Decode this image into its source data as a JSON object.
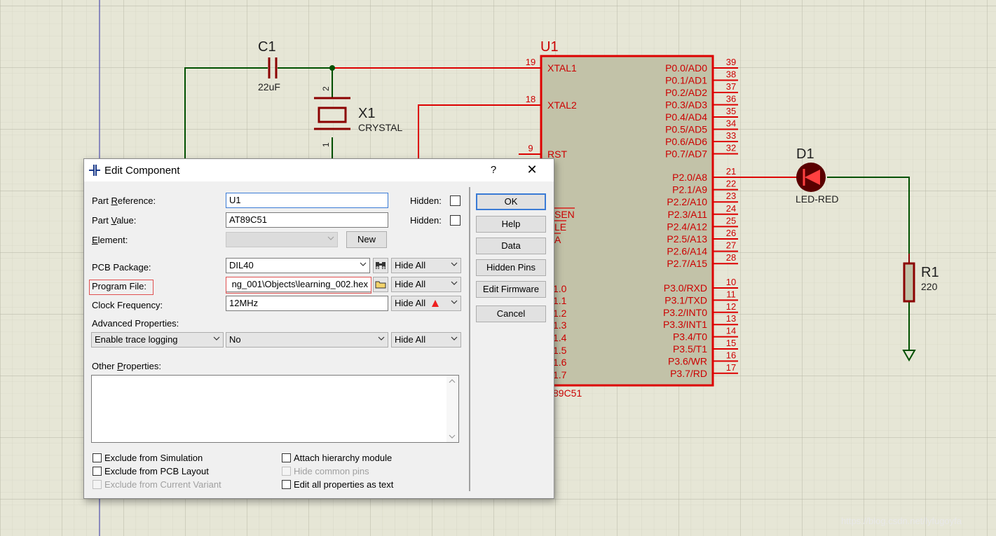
{
  "schematic": {
    "capacitor": {
      "ref": "C1",
      "value": "22uF"
    },
    "crystal": {
      "ref": "X1",
      "value": "CRYSTAL",
      "pin_top": "2",
      "pin_bottom": "1"
    },
    "ic": {
      "ref": "U1",
      "name_partial": "89C51",
      "left_pins": [
        {
          "num": "19",
          "name": "XTAL1"
        },
        {
          "num": "18",
          "name": "XTAL2"
        },
        {
          "num": "9",
          "name": "RST"
        }
      ],
      "left_partial_labels": [
        "SEN",
        "LE",
        "A",
        "1.0",
        "1.1",
        "1.2",
        "1.3",
        "1.4",
        "1.5",
        "1.6",
        "1.7"
      ],
      "right_pins": [
        {
          "name": "P0.0/AD0",
          "num": "39"
        },
        {
          "name": "P0.1/AD1",
          "num": "38"
        },
        {
          "name": "P0.2/AD2",
          "num": "37"
        },
        {
          "name": "P0.3/AD3",
          "num": "36"
        },
        {
          "name": "P0.4/AD4",
          "num": "35"
        },
        {
          "name": "P0.5/AD5",
          "num": "34"
        },
        {
          "name": "P0.6/AD6",
          "num": "33"
        },
        {
          "name": "P0.7/AD7",
          "num": "32"
        },
        {
          "name": "P2.0/A8",
          "num": "21"
        },
        {
          "name": "P2.1/A9",
          "num": "22"
        },
        {
          "name": "P2.2/A10",
          "num": "23"
        },
        {
          "name": "P2.3/A11",
          "num": "24"
        },
        {
          "name": "P2.4/A12",
          "num": "25"
        },
        {
          "name": "P2.5/A13",
          "num": "26"
        },
        {
          "name": "P2.6/A14",
          "num": "27"
        },
        {
          "name": "P2.7/A15",
          "num": "28"
        },
        {
          "name": "P3.0/RXD",
          "num": "10"
        },
        {
          "name": "P3.1/TXD",
          "num": "11"
        },
        {
          "name": "P3.2/INT0",
          "num": "12"
        },
        {
          "name": "P3.3/INT1",
          "num": "13"
        },
        {
          "name": "P3.4/T0",
          "num": "14"
        },
        {
          "name": "P3.5/T1",
          "num": "15"
        },
        {
          "name": "P3.6/WR",
          "num": "16"
        },
        {
          "name": "P3.7/RD",
          "num": "17"
        }
      ]
    },
    "led": {
      "ref": "D1",
      "value": "LED-RED"
    },
    "resistor": {
      "ref": "R1",
      "value": "220"
    }
  },
  "dialog": {
    "title": "Edit Component",
    "help_glyph": "?",
    "close_glyph": "✕",
    "part_reference": {
      "label_pre": "Part ",
      "label_u": "R",
      "label_post": "eference:",
      "value": "U1",
      "hidden_label": "Hidden:"
    },
    "part_value": {
      "label_pre": "Part ",
      "label_u": "V",
      "label_post": "alue:",
      "value": "AT89C51",
      "hidden_label": "Hidden:"
    },
    "element": {
      "label_u": "E",
      "label_post": "lement:",
      "value": "",
      "new_button": "New"
    },
    "pcb_package": {
      "label": "PCB Package:",
      "value": "DIL40",
      "visibility": "Hide All"
    },
    "program_file": {
      "label": "Program File:",
      "value": "ng_001\\Objects\\learning_002.hex",
      "visibility": "Hide All"
    },
    "clock_frequency": {
      "label": "Clock Frequency:",
      "value": "12MHz",
      "visibility": "Hide All"
    },
    "advanced_properties": {
      "label": "Advanced Properties:",
      "property": "Enable trace logging",
      "value": "No",
      "visibility": "Hide All"
    },
    "other_properties": {
      "label_pre": "Other ",
      "label_u": "P",
      "label_post": "roperties:",
      "value": ""
    },
    "checkboxes_left": [
      {
        "label": "Exclude from Simulation",
        "disabled": false
      },
      {
        "label": "Exclude from PCB Layout",
        "disabled": false
      },
      {
        "label": "Exclude from Current Variant",
        "disabled": true
      }
    ],
    "checkboxes_right": [
      {
        "label": "Attach hierarchy module",
        "disabled": false
      },
      {
        "label": "Hide common pins",
        "disabled": true
      },
      {
        "label": "Edit all properties as text",
        "disabled": false
      }
    ],
    "buttons": {
      "ok": "OK",
      "help": "Help",
      "data": "Data",
      "hidden_pins": "Hidden Pins",
      "edit_firmware": "Edit Firmware",
      "cancel": "Cancel"
    }
  },
  "watermark": "https://blog.csdn.net/lyfugoyfa"
}
